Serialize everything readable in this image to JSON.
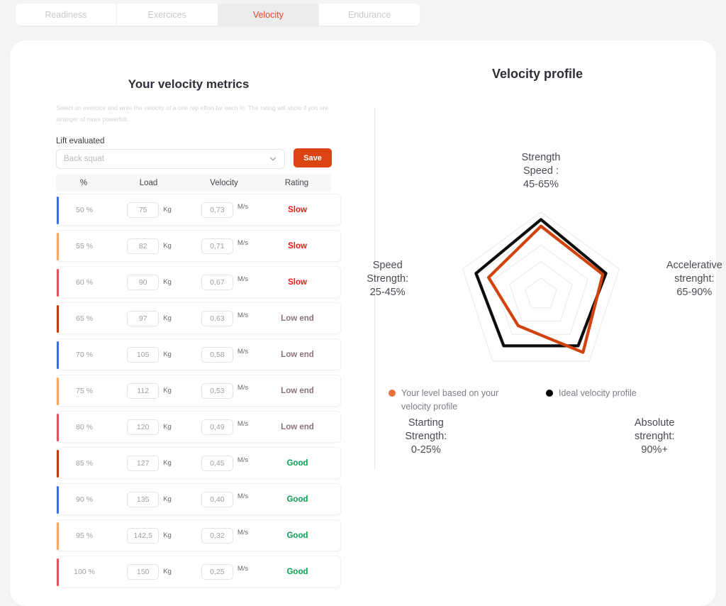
{
  "tabs": [
    {
      "label": "Readiness",
      "active": false
    },
    {
      "label": "Exercices",
      "active": false
    },
    {
      "label": "Velocity",
      "active": true
    },
    {
      "label": "Endurance",
      "active": false
    }
  ],
  "left_panel": {
    "title": "Your velocity metrics",
    "description": "Select an exercice and write the velocity of a one rep effort for each %. The rating will show if you are stronger of more powerfull.",
    "field_label": "Lift evaluated",
    "select_value": "Back squat",
    "select_icon": "chevron-down-icon",
    "save_label": "Save",
    "columns": [
      "%",
      "Load",
      "Velocity",
      "Rating"
    ],
    "load_unit": "Kg",
    "velocity_unit": "M/s",
    "rows": [
      {
        "pct": "50 %",
        "load": "75",
        "velocity": "0,73",
        "rating": "Slow",
        "rating_color": "#fb1414",
        "accent": "#3b6fe0"
      },
      {
        "pct": "55 %",
        "load": "82",
        "velocity": "0,71",
        "rating": "Slow",
        "rating_color": "#fb1414",
        "accent": "#f7a95f"
      },
      {
        "pct": "60 %",
        "load": "90",
        "velocity": "0,67",
        "rating": "Slow",
        "rating_color": "#fb1414",
        "accent": "#e4505e"
      },
      {
        "pct": "65 %",
        "load": "97",
        "velocity": "0,63",
        "rating": "Low end",
        "rating_color": "#8a7378",
        "accent": "#c43b08"
      },
      {
        "pct": "70 %",
        "load": "105",
        "velocity": "0,58",
        "rating": "Low end",
        "rating_color": "#8a7378",
        "accent": "#3b6fe0"
      },
      {
        "pct": "75 %",
        "load": "112",
        "velocity": "0,53",
        "rating": "Low end",
        "rating_color": "#8a7378",
        "accent": "#f7a95f"
      },
      {
        "pct": "80 %",
        "load": "120",
        "velocity": "0,49",
        "rating": "Low end",
        "rating_color": "#8a7378",
        "accent": "#e4505e"
      },
      {
        "pct": "85 %",
        "load": "127",
        "velocity": "0,45",
        "rating": "Good",
        "rating_color": "#07a14f",
        "accent": "#c43b08"
      },
      {
        "pct": "90 %",
        "load": "135",
        "velocity": "0,40",
        "rating": "Good",
        "rating_color": "#07a14f",
        "accent": "#3b6fe0"
      },
      {
        "pct": "95 %",
        "load": "142,5",
        "velocity": "0,32",
        "rating": "Good",
        "rating_color": "#07a14f",
        "accent": "#f7a95f"
      },
      {
        "pct": "100 %",
        "load": "150",
        "velocity": "0,25",
        "rating": "Good",
        "rating_color": "#07a14f",
        "accent": "#e4505e"
      }
    ]
  },
  "right_panel": {
    "title": "Velocity profile",
    "legend": [
      {
        "label": "Your level based on your\nvelocity profile",
        "color": "#e8703c"
      },
      {
        "label": "Ideal velocity profile",
        "color": "#000000"
      }
    ]
  },
  "chart_data": {
    "type": "radar",
    "title": "Velocity profile",
    "grid_rings": 5,
    "max": 5,
    "axes": [
      {
        "label": "Strength\nSpeed :\n45-65%",
        "name": "strength-speed"
      },
      {
        "label": "Accelerative\nstrenght:\n65-90%",
        "name": "accelerative-strength"
      },
      {
        "label": "Absolute\nstrenght:\n90%+",
        "name": "absolute-strength"
      },
      {
        "label": "Starting\nStrength:\n0-25%",
        "name": "starting-strength"
      },
      {
        "label": "Speed\nStrength:\n25-45%",
        "name": "speed-strength"
      }
    ],
    "series": [
      {
        "name": "Ideal velocity profile",
        "color": "#0d0d0d",
        "values": [
          4.55,
          4.15,
          3.85,
          3.85,
          4.15
        ]
      },
      {
        "name": "Your level based on your velocity profile",
        "color": "#d2420d",
        "values": [
          4.15,
          3.95,
          4.35,
          2.35,
          3.35
        ]
      }
    ],
    "legend_position": "bottom-left"
  }
}
